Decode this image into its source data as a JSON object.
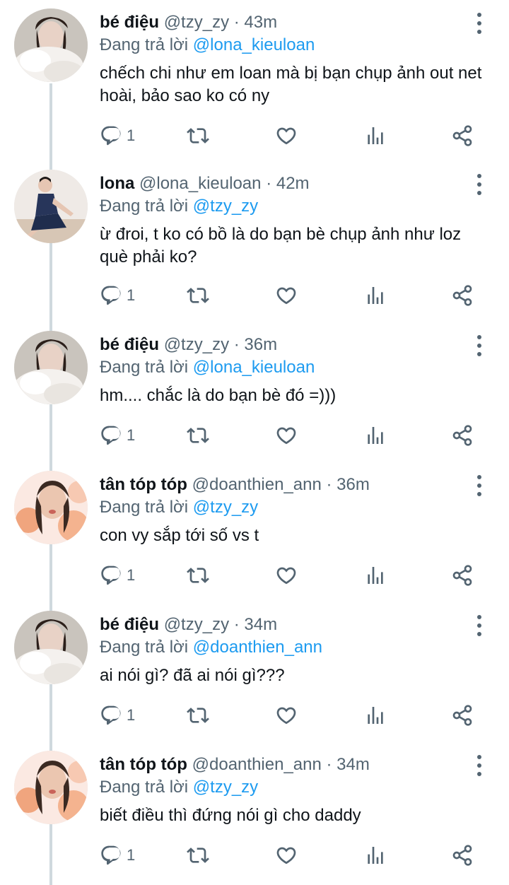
{
  "replying_to_label": "Đang trả lời",
  "colors": {
    "text": "#0f1419",
    "secondary": "#536471",
    "accent": "#1d9bf0",
    "thread_line": "#cfd9de"
  },
  "icons": {
    "reply": "reply-icon",
    "retweet": "retweet-icon",
    "like": "heart-icon",
    "views": "analytics-icon",
    "share": "share-icon",
    "more": "more-vertical-icon"
  },
  "tweets": [
    {
      "name": "bé điệu",
      "handle": "@tzy_zy",
      "time": "43m",
      "reply_to": "@lona_kieuloan",
      "text": "chếch chi như em loan mà bị bạn chụp ảnh out net hoài, bảo sao ko có ny",
      "reply_count": "1",
      "avatar": "fur-avatar"
    },
    {
      "name": "lona",
      "handle": "@lona_kieuloan",
      "time": "42m",
      "reply_to": "@tzy_zy",
      "text": "ừ đroi, t ko có bồ là do bạn bè chụp ảnh như loz què phải ko?",
      "reply_count": "1",
      "avatar": "dress-avatar"
    },
    {
      "name": "bé điệu",
      "handle": "@tzy_zy",
      "time": "36m",
      "reply_to": "@lona_kieuloan",
      "text": "hm.... chắc là do bạn bè đó =)))",
      "reply_count": "1",
      "avatar": "fur-avatar"
    },
    {
      "name": "tân tóp tóp",
      "handle": "@doanthien_ann",
      "time": "36m",
      "reply_to": "@tzy_zy",
      "text": "con vy sắp tới số vs t",
      "reply_count": "1",
      "avatar": "flower-avatar"
    },
    {
      "name": "bé điệu",
      "handle": "@tzy_zy",
      "time": "34m",
      "reply_to": "@doanthien_ann",
      "text": "ai nói gì? đã ai nói gì???",
      "reply_count": "1",
      "avatar": "fur-avatar"
    },
    {
      "name": "tân tóp tóp",
      "handle": "@doanthien_ann",
      "time": "34m",
      "reply_to": "@tzy_zy",
      "text": "biết điều thì đứng nói gì cho daddy",
      "reply_count": "1",
      "avatar": "flower-avatar"
    }
  ]
}
